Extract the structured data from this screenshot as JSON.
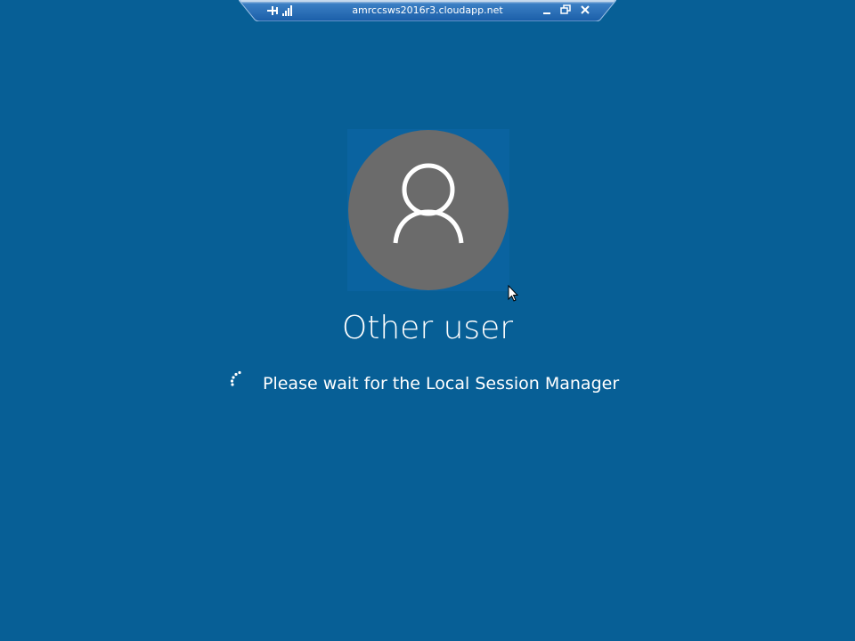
{
  "rdp_bar": {
    "host": "amrccsws2016r3.cloudapp.net",
    "pin_icon": "pin-icon",
    "signal_icon": "connection-quality-icon",
    "minimize_icon": "minimize-icon",
    "restore_icon": "restore-icon",
    "close_icon": "close-icon"
  },
  "login": {
    "avatar_icon": "user-silhouette-icon",
    "user_name": "Other user",
    "status_message": "Please wait for the Local Session Manager",
    "spinner_icon": "loading-spinner-icon"
  },
  "colors": {
    "background": "#075f96",
    "avatar": "#6b6b6b",
    "text": "#ffffff",
    "rdp_bar": "#2a70b8"
  }
}
